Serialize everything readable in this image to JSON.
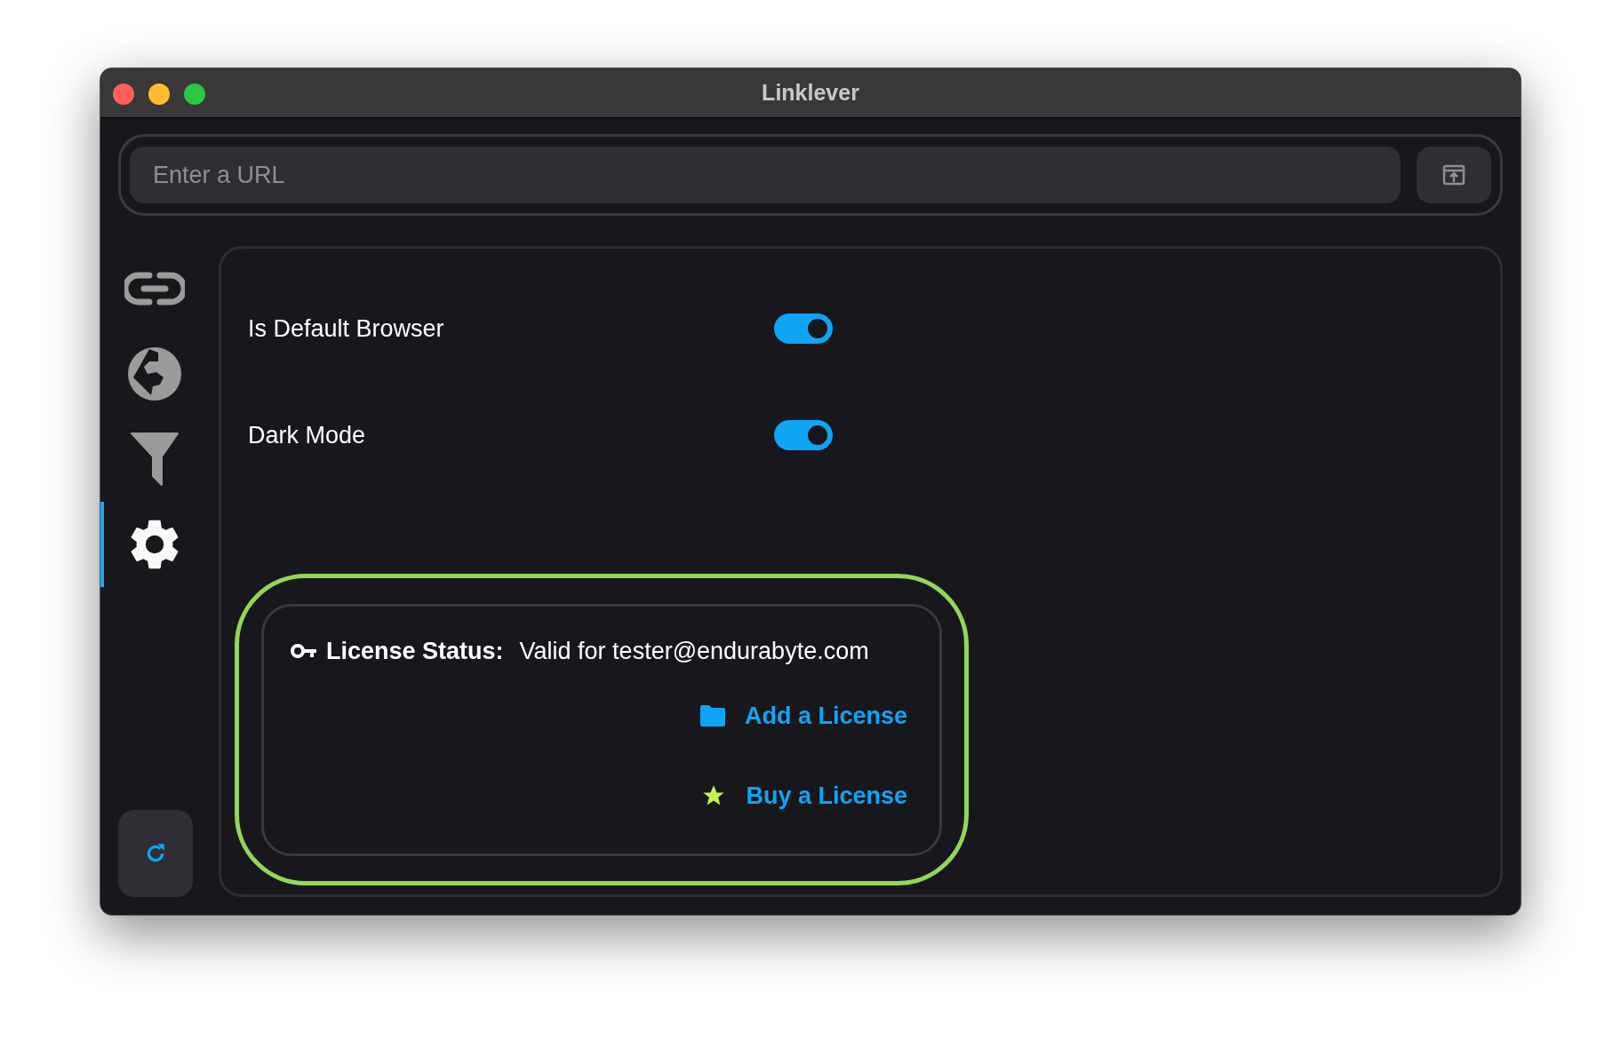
{
  "window": {
    "title": "Linklever"
  },
  "url_bar": {
    "placeholder": "Enter a URL"
  },
  "sidebar": {
    "items": [
      {
        "kind": "link",
        "selected": false
      },
      {
        "kind": "globe",
        "selected": false
      },
      {
        "kind": "filter",
        "selected": false
      },
      {
        "kind": "settings",
        "selected": true
      }
    ]
  },
  "settings": [
    {
      "label": "Is Default Browser",
      "on": true
    },
    {
      "label": "Dark Mode",
      "on": true
    }
  ],
  "license": {
    "label": "License Status:",
    "value": "Valid for tester@endurabyte.com",
    "highlighted": true,
    "actions": [
      {
        "kind": "folder",
        "label": "Add a License"
      },
      {
        "kind": "star",
        "label": "Buy a License"
      }
    ]
  }
}
